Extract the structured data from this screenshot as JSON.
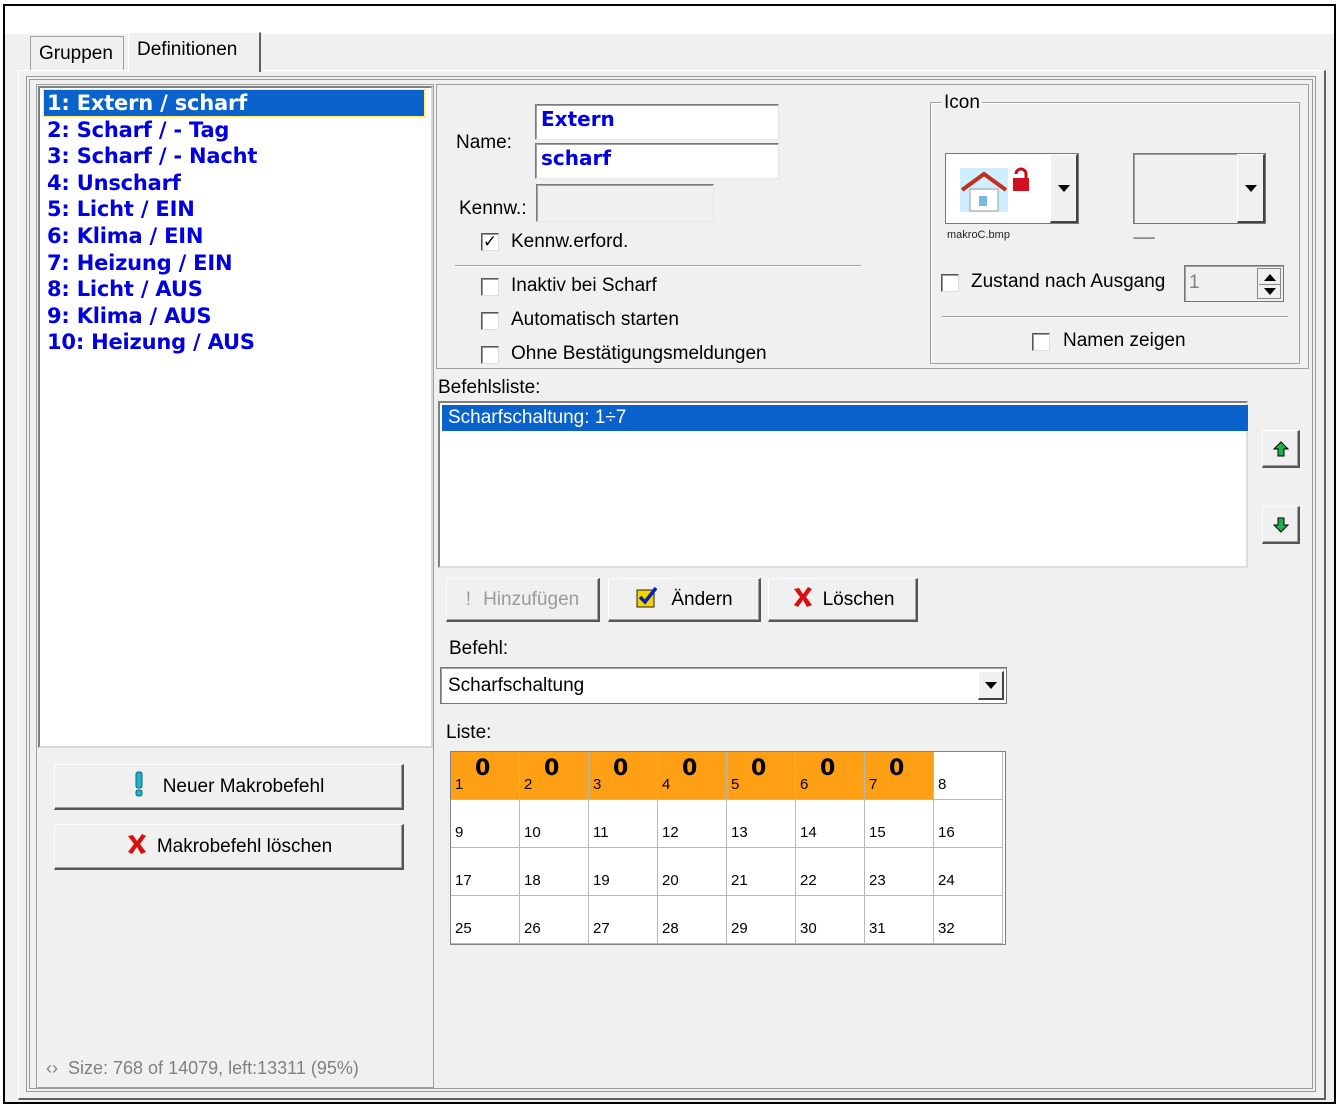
{
  "tabs": [
    "Gruppen",
    "Definitionen"
  ],
  "macros": [
    "1: Extern / scharf",
    "2: Scharf / - Tag",
    "3: Scharf / - Nacht",
    "4: Unscharf",
    "5: Licht / EIN",
    "6: Klima / EIN",
    "7: Heizung / EIN",
    "8: Licht / AUS",
    "9: Klima / AUS",
    "10: Heizung / AUS"
  ],
  "left_buttons": {
    "new": "Neuer Makrobefehl",
    "delete": "Makrobefehl löschen"
  },
  "status": "Size: 768 of 14079, left:13311 (95%)",
  "props": {
    "name_label": "Name:",
    "name_line1": "Extern",
    "name_line2": "scharf",
    "password_label": "Kennw.:",
    "password_value": "",
    "password_required_label": "Kennw.erford.",
    "password_required_checked": true,
    "inactive_label": "Inaktiv bei Scharf",
    "autostart_label": "Automatisch starten",
    "noconfirm_label": "Ohne Bestätigungsmeldungen"
  },
  "icon_group": {
    "title": "Icon",
    "icon1_file": "makroC.bmp",
    "icon2_file": "--------",
    "state_label": "Zustand nach Ausgang",
    "state_value": "1",
    "show_names_label": "Namen zeigen"
  },
  "commands": {
    "label": "Befehlsliste:",
    "items": [
      "Scharfschaltung: 1÷7"
    ],
    "add_label": "Hinzufügen",
    "edit_label": "Ändern",
    "delete_label": "Löschen",
    "command_label": "Befehl:",
    "command_value": "Scharfschaltung",
    "list_label": "Liste:"
  },
  "grid": {
    "active": [
      1,
      2,
      3,
      4,
      5,
      6,
      7
    ],
    "active_value": "0",
    "numbers": [
      1,
      2,
      3,
      4,
      5,
      6,
      7,
      8,
      9,
      10,
      11,
      12,
      13,
      14,
      15,
      16,
      17,
      18,
      19,
      20,
      21,
      22,
      23,
      24,
      25,
      26,
      27,
      28,
      29,
      30,
      31,
      32
    ]
  },
  "colors": {
    "selection": "#0a62cc",
    "list_text": "#0000e0",
    "active_cell": "#ff9f14"
  }
}
